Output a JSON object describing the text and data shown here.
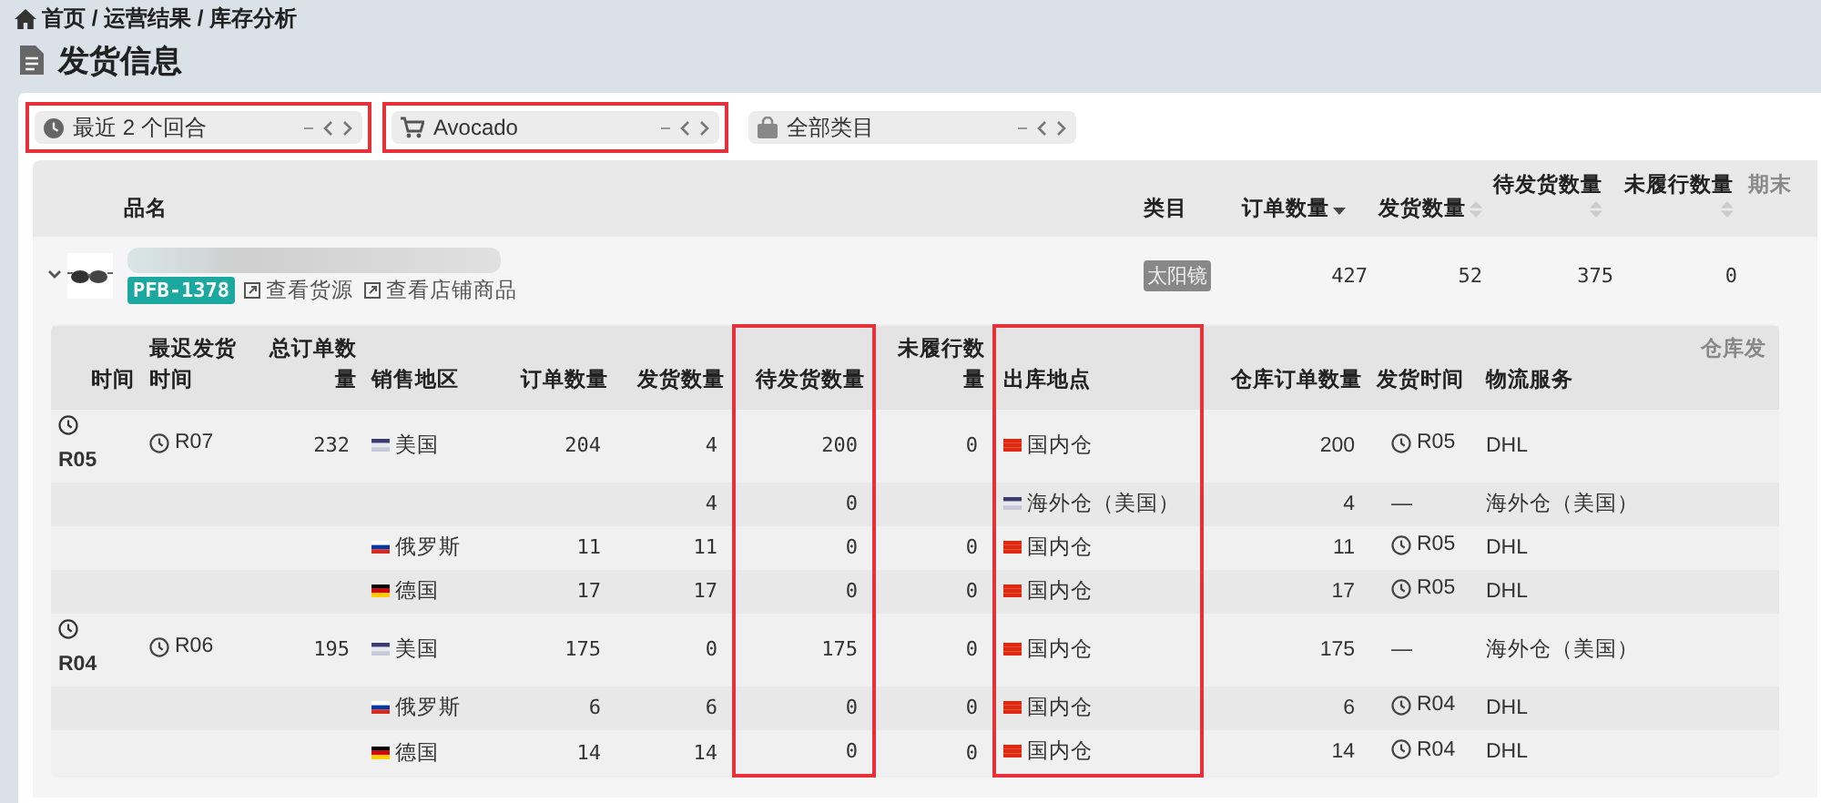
{
  "breadcrumb": "首页 / 运营结果 / 库存分析",
  "title": "发货信息",
  "filters": [
    {
      "kind": "clock",
      "label": "最近 2 个回合",
      "highlighted": true
    },
    {
      "kind": "cart",
      "label": "Avocado",
      "highlighted": true
    },
    {
      "kind": "bag",
      "label": "全部类目",
      "highlighted": false
    }
  ],
  "product_table": {
    "columns": [
      {
        "label": "品名",
        "sortable": false
      },
      {
        "label": "类目",
        "sortable": false
      },
      {
        "label": "订单数量",
        "sortable": true,
        "sorted": true
      },
      {
        "label": "发货数量",
        "sortable": true,
        "sorted": false
      },
      {
        "label": "待发货数量",
        "sortable": true,
        "sorted": false
      },
      {
        "label": "未履行数量",
        "sortable": true,
        "sorted": false
      },
      {
        "label": "期末",
        "sortable": false
      }
    ],
    "product": {
      "expanded": true,
      "name_blurred": true,
      "sku": "PFB-1378",
      "links": [
        "查看货源",
        "查看店铺商品"
      ],
      "category": "太阳镜",
      "orders": "427",
      "shipped": "52",
      "pending": "375",
      "unfulfilled": "0"
    }
  },
  "detail_table": {
    "columns": [
      {
        "label": "时间",
        "highlighted": false
      },
      {
        "label": "最迟发货时间",
        "highlighted": false
      },
      {
        "label": "总订单数量",
        "highlighted": false
      },
      {
        "label": "销售地区",
        "highlighted": false
      },
      {
        "label": "订单数量",
        "highlighted": false
      },
      {
        "label": "发货数量",
        "highlighted": false
      },
      {
        "label": "待发货数量",
        "highlighted": true
      },
      {
        "label": "未履行数量",
        "highlighted": false
      },
      {
        "label": "出库地点",
        "highlighted": true
      },
      {
        "label": "仓库订单数量",
        "highlighted": false
      },
      {
        "label": "发货时间",
        "highlighted": false
      },
      {
        "label": "物流服务",
        "highlighted": false
      },
      {
        "label": "仓库发",
        "highlighted": false
      }
    ],
    "groups": [
      {
        "time": "R05",
        "last_ship": "R07",
        "total": "232",
        "rows": [
          {
            "region": {
              "label": "美国",
              "kind": "us"
            },
            "orders": "204",
            "shipped": "4",
            "pending": "200",
            "unfulfilled": "0",
            "warehouse": {
              "label": "国内仓",
              "kind": "cn"
            },
            "wh_orders": "200",
            "ship_time": "R05",
            "clock": true,
            "logistics": "DHL"
          },
          {
            "shipped": "4",
            "pending": "0",
            "warehouse": {
              "label": "海外仓（美国）",
              "kind": "us"
            },
            "wh_orders": "4",
            "ship_time": "—",
            "clock": false,
            "logistics": "海外仓（美国）"
          },
          {
            "region": {
              "label": "俄罗斯",
              "kind": "ru"
            },
            "orders": "11",
            "shipped": "11",
            "pending": "0",
            "unfulfilled": "0",
            "warehouse": {
              "label": "国内仓",
              "kind": "cn"
            },
            "wh_orders": "11",
            "ship_time": "R05",
            "clock": true,
            "logistics": "DHL"
          },
          {
            "region": {
              "label": "德国",
              "kind": "de"
            },
            "orders": "17",
            "shipped": "17",
            "pending": "0",
            "unfulfilled": "0",
            "warehouse": {
              "label": "国内仓",
              "kind": "cn"
            },
            "wh_orders": "17",
            "ship_time": "R05",
            "clock": true,
            "logistics": "DHL"
          }
        ]
      },
      {
        "time": "R04",
        "last_ship": "R06",
        "total": "195",
        "rows": [
          {
            "region": {
              "label": "美国",
              "kind": "us"
            },
            "orders": "175",
            "shipped": "0",
            "pending": "175",
            "unfulfilled": "0",
            "warehouse": {
              "label": "国内仓",
              "kind": "cn"
            },
            "wh_orders": "175",
            "ship_time": "—",
            "clock": false,
            "logistics": "海外仓（美国）"
          },
          {
            "region": {
              "label": "俄罗斯",
              "kind": "ru"
            },
            "orders": "6",
            "shipped": "6",
            "pending": "0",
            "unfulfilled": "0",
            "warehouse": {
              "label": "国内仓",
              "kind": "cn"
            },
            "wh_orders": "6",
            "ship_time": "R04",
            "clock": true,
            "logistics": "DHL"
          },
          {
            "region": {
              "label": "德国",
              "kind": "de"
            },
            "orders": "14",
            "shipped": "14",
            "pending": "0",
            "unfulfilled": "0",
            "warehouse": {
              "label": "国内仓",
              "kind": "cn"
            },
            "wh_orders": "14",
            "ship_time": "R04",
            "clock": true,
            "logistics": "DHL"
          }
        ]
      }
    ]
  }
}
